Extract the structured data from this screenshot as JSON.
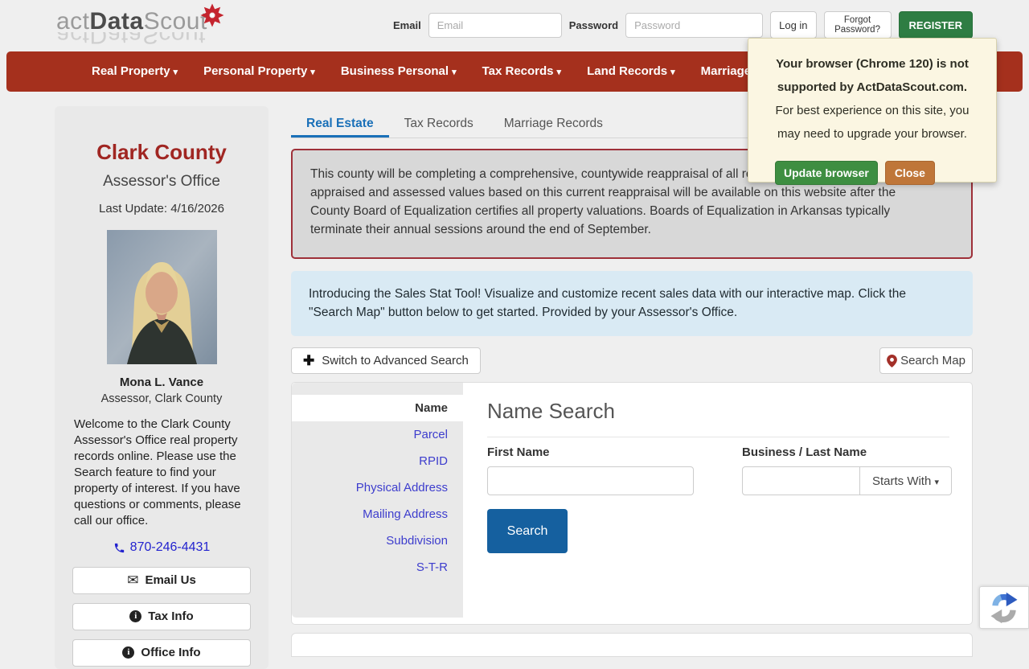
{
  "header": {
    "logo_act": "act",
    "logo_data": "Data",
    "logo_scout": "Scout",
    "email_label": "Email",
    "email_placeholder": "Email",
    "password_label": "Password",
    "password_placeholder": "Password",
    "login_button": "Log in",
    "forgot_button": "Forgot Password?",
    "register_button": "REGISTER"
  },
  "nav": {
    "items": [
      {
        "label": "Real Property"
      },
      {
        "label": "Personal Property"
      },
      {
        "label": "Business Personal"
      },
      {
        "label": "Tax Records"
      },
      {
        "label": "Land Records"
      },
      {
        "label": "Marriage Records"
      }
    ]
  },
  "browser_popup": {
    "message_bold": "Your browser (Chrome 120) is not\nsupported by ActDataScout.com.",
    "message": "For best experience on this site, you\nmay need to upgrade your browser.",
    "update_button": "Update browser",
    "close_button": "Close"
  },
  "sidebar": {
    "county": "Clark County",
    "office": "Assessor's Office",
    "last_update": "Last Update: 4/16/2026",
    "assessor_name": "Mona L. Vance",
    "assessor_title": "Assessor, Clark County",
    "welcome": "Welcome to the Clark County\nAssessor's Office real property\nrecords online. Please use the\nSearch feature to find your\nproperty of interest. If you have\nquestions or comments, please\ncall our office.",
    "phone": "870-246-4431",
    "email_button": "Email Us",
    "tax_button": "Tax Info",
    "office_button": "Office Info"
  },
  "main": {
    "tabs": [
      {
        "label": "Real Estate",
        "active": true
      },
      {
        "label": "Tax Records",
        "active": false
      },
      {
        "label": "Marriage Records",
        "active": false
      }
    ],
    "notice": "This county will be completing a comprehensive, countywide reappraisal of all real property. Newly\nappraised and assessed values based on this current reappraisal will be available on this website after the\nCounty Board of Equalization certifies all property valuations. Boards of Equalization in Arkansas typically\nterminate their annual sessions around the end of September.",
    "sales_tool_info": "Introducing the Sales Stat Tool! Visualize and customize recent sales data with our interactive map. Click the\n\"Search Map\" button below to get started. Provided by your Assessor's Office.",
    "advanced_search_button": "Switch to Advanced Search",
    "search_map_button": "Search Map",
    "search_nav": {
      "items": [
        "Name",
        "Parcel",
        "RPID",
        "Physical Address",
        "Mailing Address",
        "Subdivision",
        "S-T-R"
      ],
      "active": "Name"
    },
    "name_search": {
      "title": "Name Search",
      "first_name_label": "First Name",
      "first_name_value": "",
      "last_name_label": "Business / Last Name",
      "last_name_value": "",
      "match_mode": "Starts With",
      "search_button": "Search"
    }
  },
  "colors": {
    "navbar_red": "#a5301d",
    "county_red": "#a02622",
    "active_tab_blue": "#1a70b8",
    "search_button_blue": "#15609f",
    "register_green": "#2e7d43",
    "update_green": "#3e8e41",
    "close_orange": "#bf7639",
    "link_violet": "#3d3dcd",
    "popup_cream": "#fbf6e2",
    "info_box_blue": "#d9eaf4"
  }
}
